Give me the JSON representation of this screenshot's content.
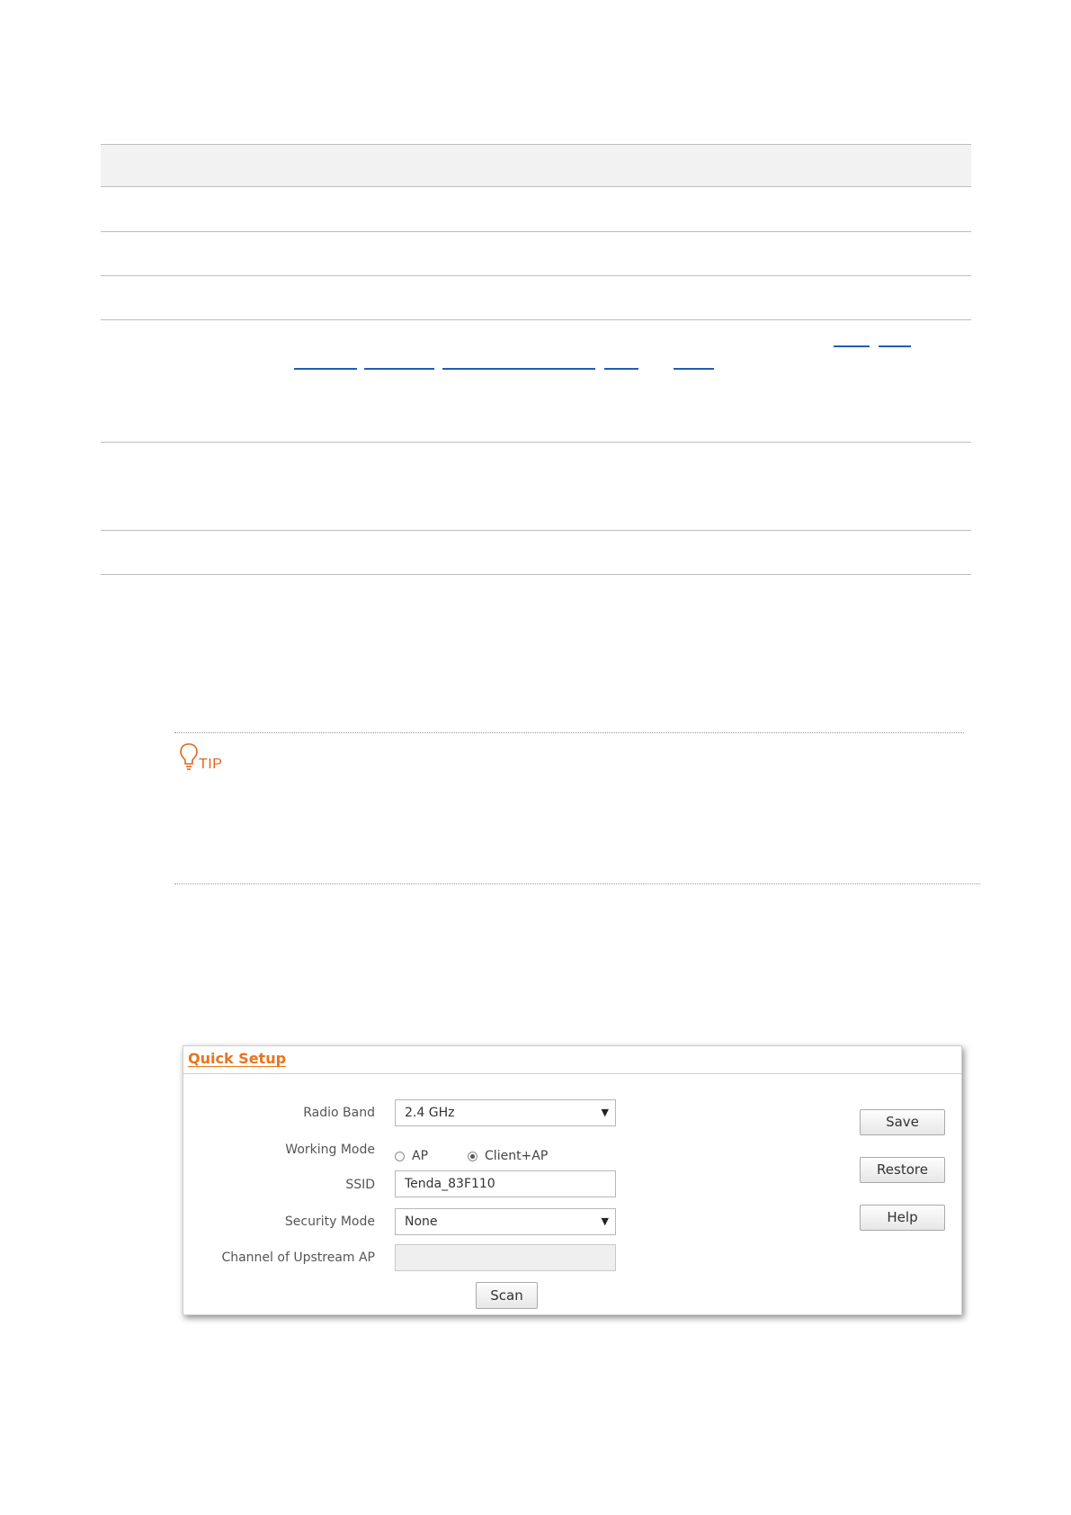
{
  "tip": {
    "label": "TIP"
  },
  "quick_setup": {
    "title": "Quick Setup",
    "radio_band": {
      "label": "Radio Band",
      "value": "2.4 GHz"
    },
    "working_mode": {
      "label": "Working Mode",
      "options": [
        {
          "label": "AP",
          "checked": false
        },
        {
          "label": "Client+AP",
          "checked": true
        }
      ]
    },
    "ssid": {
      "label": "SSID",
      "value": "Tenda_83F110"
    },
    "security_mode": {
      "label": "Security Mode",
      "value": "None"
    },
    "channel_upstream": {
      "label": "Channel of Upstream AP",
      "value": ""
    },
    "scan_label": "Scan",
    "save_label": "Save",
    "restore_label": "Restore",
    "help_label": "Help"
  },
  "colors": {
    "accent": "#e8741e",
    "tip": "#e0651f",
    "link": "#1f5fb4"
  },
  "icons": {
    "tip": "lightbulb-icon",
    "dropdown": "triangle-down-icon"
  }
}
